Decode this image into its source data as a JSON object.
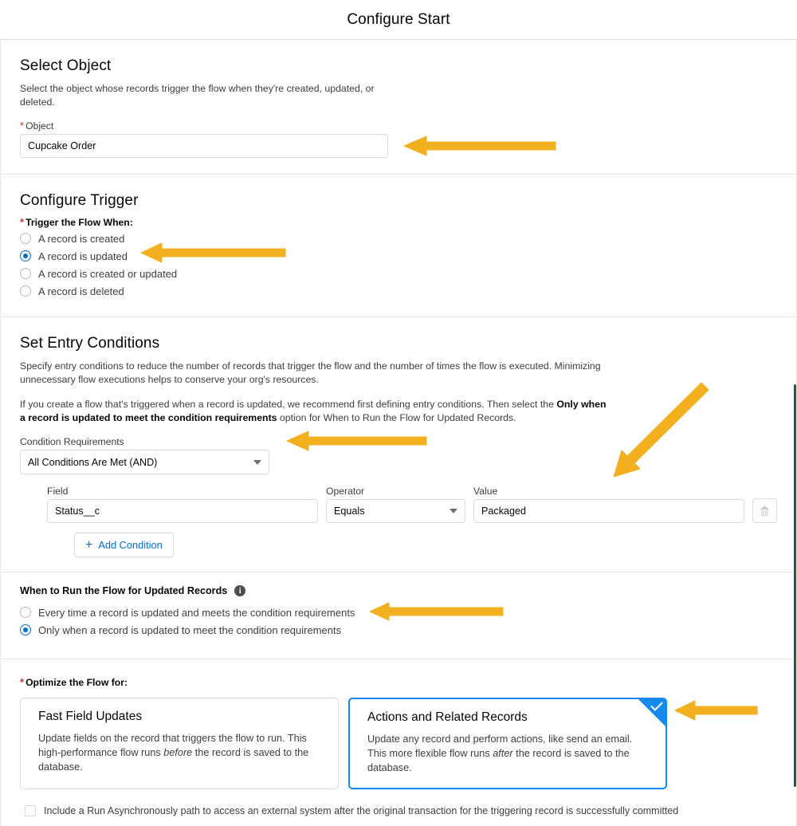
{
  "header": {
    "title": "Configure Start"
  },
  "select_object": {
    "title": "Select Object",
    "description": "Select the object whose records trigger the flow when they're created, updated, or deleted.",
    "object_label": "Object",
    "object_value": "Cupcake Order",
    "required_marker": "*"
  },
  "configure_trigger": {
    "title": "Configure Trigger",
    "legend": "Trigger the Flow When:",
    "options": [
      {
        "label": "A record is created",
        "selected": false
      },
      {
        "label": "A record is updated",
        "selected": true
      },
      {
        "label": "A record is created or updated",
        "selected": false
      },
      {
        "label": "A record is deleted",
        "selected": false
      }
    ]
  },
  "entry_conditions": {
    "title": "Set Entry Conditions",
    "paragraph1": "Specify entry conditions to reduce the number of records that trigger the flow and the number of times the flow is executed. Minimizing unnecessary flow executions helps to conserve your org's resources.",
    "paragraph2_pre": "If you create a flow that's triggered when a record is updated, we recommend first defining entry conditions. Then select the ",
    "paragraph2_bold": "Only when a record is updated to meet the condition requirements",
    "paragraph2_post": " option for When to Run the Flow for Updated Records.",
    "condition_requirements_label": "Condition Requirements",
    "condition_requirements_value": "All Conditions Are Met (AND)",
    "columns": {
      "field": "Field",
      "operator": "Operator",
      "value": "Value"
    },
    "rows": [
      {
        "field": "Status__c",
        "operator": "Equals",
        "value": "Packaged"
      }
    ],
    "delete_icon": "trash-icon",
    "add_condition_label": "Add Condition",
    "add_condition_icon": "plus-icon"
  },
  "when_to_run": {
    "title": "When to Run the Flow for Updated Records",
    "info_icon": "info-icon",
    "options": [
      {
        "label": "Every time a record is updated and meets the condition requirements",
        "selected": false
      },
      {
        "label": "Only when a record is updated to meet the condition requirements",
        "selected": true
      }
    ]
  },
  "optimize": {
    "legend": "Optimize the Flow for:",
    "required_marker": "*",
    "cards": [
      {
        "title": "Fast Field Updates",
        "body_pre": "Update fields on the record that triggers the flow to run. This high-performance flow runs ",
        "body_em": "before",
        "body_post": " the record is saved to the database.",
        "selected": false
      },
      {
        "title": "Actions and Related Records",
        "body_pre": "Update any record and perform actions, like send an email. This more flexible flow runs ",
        "body_em": "after",
        "body_post": " the record is saved to the database.",
        "selected": true
      }
    ]
  },
  "async_option": {
    "label": "Include a Run Asynchronously path to access an external system after the original transaction for the triggering record is successfully committed",
    "checked": false
  },
  "colors": {
    "annotation_arrow": "#f2b01e",
    "accent_blue": "#0070d2",
    "selected_card_border": "#1589ee",
    "required_red": "#c23934",
    "scrollbar_thumb": "#2f5741"
  }
}
